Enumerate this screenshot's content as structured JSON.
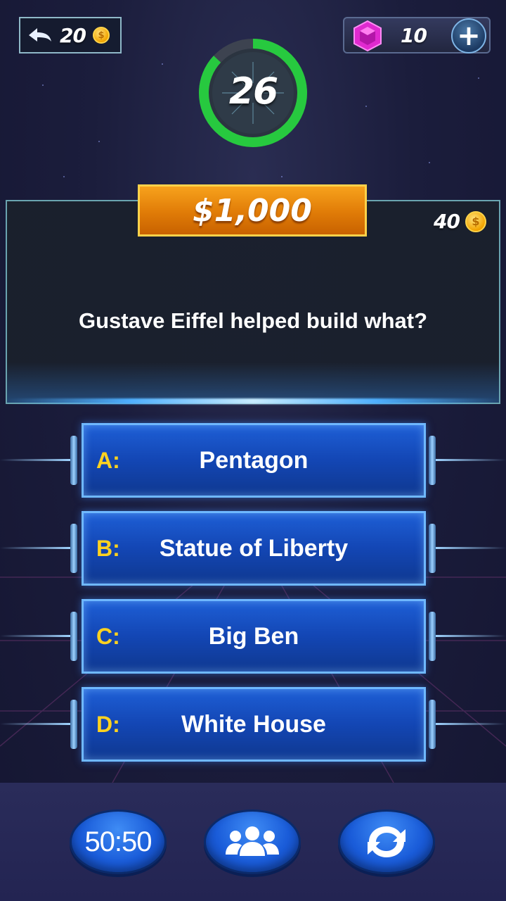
{
  "top_bar": {
    "back_count": "20",
    "gem_count": "10",
    "plus_label": "+"
  },
  "timer": {
    "seconds": "26",
    "progress": 0.87,
    "color": "#27c93f"
  },
  "question": {
    "prize": "$1,000",
    "coin_reward": "40",
    "text": "Gustave Eiffel helped build what?"
  },
  "answers": [
    {
      "letter": "A:",
      "text": "Pentagon"
    },
    {
      "letter": "B:",
      "text": "Statue of Liberty"
    },
    {
      "letter": "C:",
      "text": "Big Ben"
    },
    {
      "letter": "D:",
      "text": "White House"
    }
  ],
  "lifelines": {
    "fifty_fifty_label": "50:50",
    "audience_icon": "audience-icon",
    "switch_icon": "switch-question-icon"
  },
  "colors": {
    "prize_orange": "#e07b07",
    "answer_blue": "#1346b4",
    "letter_yellow": "#ffd21f"
  }
}
